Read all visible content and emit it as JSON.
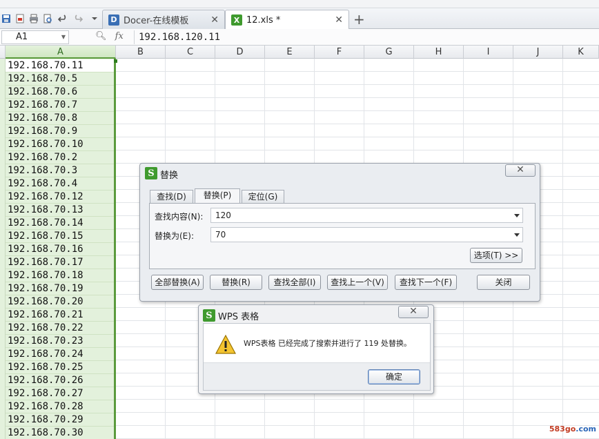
{
  "tabs": [
    {
      "label": "Docer-在线模板",
      "active": false
    },
    {
      "label": "12.xls *",
      "active": true
    }
  ],
  "formula": {
    "cell_ref": "A1",
    "fx_label": "fx",
    "value": "192.168.120.11"
  },
  "columns": [
    "A",
    "B",
    "C",
    "D",
    "E",
    "F",
    "G",
    "H",
    "I",
    "J",
    "K"
  ],
  "column_a_values": [
    "192.168.70.11",
    "192.168.70.5",
    "192.168.70.6",
    "192.168.70.7",
    "192.168.70.8",
    "192.168.70.9",
    "192.168.70.10",
    "192.168.70.2",
    "192.168.70.3",
    "192.168.70.4",
    "192.168.70.12",
    "192.168.70.13",
    "192.168.70.14",
    "192.168.70.15",
    "192.168.70.16",
    "192.168.70.17",
    "192.168.70.18",
    "192.168.70.19",
    "192.168.70.20",
    "192.168.70.21",
    "192.168.70.22",
    "192.168.70.23",
    "192.168.70.24",
    "192.168.70.25",
    "192.168.70.26",
    "192.168.70.27",
    "192.168.70.28",
    "192.168.70.29",
    "192.168.70.30"
  ],
  "replace_dialog": {
    "title": "替换",
    "close": "✕",
    "tabs": [
      "查找(D)",
      "替换(P)",
      "定位(G)"
    ],
    "find_label": "查找内容(N):",
    "find_value": "120",
    "replace_label": "替换为(E):",
    "replace_value": "70",
    "options_button": "选项(T) >>",
    "buttons": [
      "全部替换(A)",
      "替换(R)",
      "查找全部(I)",
      "查找上一个(V)",
      "查找下一个(F)",
      "关闭"
    ]
  },
  "message_box": {
    "title": "WPS 表格",
    "close": "✕",
    "message": "WPS表格 已经完成了搜索并进行了 119 处替换。",
    "ok_button": "确定"
  },
  "watermark": {
    "part1": "583go",
    "part2": ".com"
  },
  "colors": {
    "selection_green": "#5a9a3c",
    "logo_green": "#3f9a2e",
    "column_fill": "#e3f1dc"
  }
}
